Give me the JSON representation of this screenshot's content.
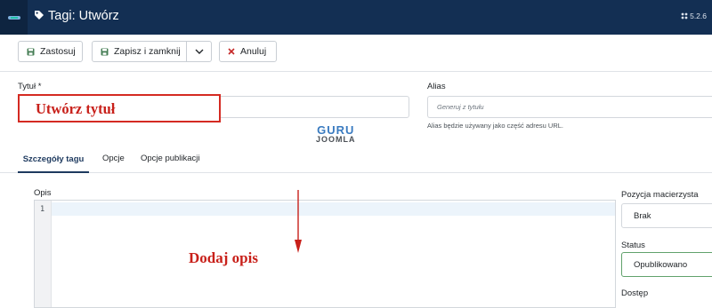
{
  "header": {
    "title": "Tagi: Utwórz",
    "version": "5.2.6"
  },
  "toolbar": {
    "apply_label": "Zastosuj",
    "save_close_label": "Zapisz i zamknij",
    "cancel_label": "Anuluj"
  },
  "form": {
    "title_label": "Tytuł *",
    "title_value": "",
    "alias_label": "Alias",
    "alias_placeholder": "Generuj z tytułu",
    "alias_hint": "Alias będzie używany jako część adresu URL."
  },
  "annotations": {
    "title_callout": "Utwórz tytuł",
    "description_callout": "Dodaj opis"
  },
  "watermark": {
    "line1": "GURU",
    "line2": "JOOMLA"
  },
  "tabs": [
    {
      "label": "Szczegóły tagu",
      "active": true
    },
    {
      "label": "Opcje",
      "active": false
    },
    {
      "label": "Opcje publikacji",
      "active": false
    }
  ],
  "editor": {
    "label": "Opis",
    "line_number": "1"
  },
  "sidebar": {
    "parent_label": "Pozycja macierzysta",
    "parent_value": "Brak",
    "status_label": "Status",
    "status_value": "Opublikowano",
    "access_label": "Dostęp"
  },
  "colors": {
    "header_bg": "#132f53",
    "annotation_red": "#c8201a",
    "save_icon_green": "#457d54",
    "cancel_icon_red": "#c52827",
    "active_tab": "#1e3a5f",
    "status_border": "#61a26c"
  }
}
